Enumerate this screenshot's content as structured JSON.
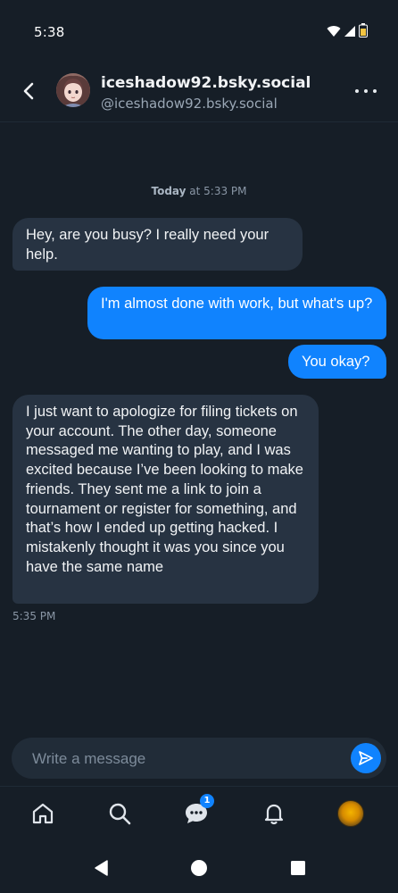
{
  "status_bar": {
    "time": "5:38"
  },
  "header": {
    "display_name": "iceshadow92.bsky.social",
    "handle": "@iceshadow92.bsky.social"
  },
  "conversation": {
    "date_label": "Today",
    "date_time": " at 5:33 PM",
    "messages": [
      {
        "direction": "incoming",
        "text": "Hey, are you busy? I really need your help."
      },
      {
        "direction": "outgoing",
        "text": "I'm almost done with work, but what's up?"
      },
      {
        "direction": "outgoing",
        "text": "You okay?"
      },
      {
        "direction": "incoming",
        "text": "I just want to apologize for filing tickets on your account. The other day, someone messaged me wanting to play, and I was excited because I’ve been looking to make friends. They sent me a link to join a tournament or register for something, and that’s how I ended up getting hacked. I mistakenly thought it was you since you have the same name"
      }
    ],
    "last_message_time": "5:35 PM"
  },
  "composer": {
    "placeholder": "Write a message",
    "value": ""
  },
  "bottom_nav": {
    "items": [
      {
        "icon": "home-icon"
      },
      {
        "icon": "search-icon"
      },
      {
        "icon": "chat-icon",
        "badge": "1"
      },
      {
        "icon": "bell-icon"
      },
      {
        "icon": "profile-avatar"
      }
    ]
  },
  "colors": {
    "background": "#161e27",
    "incoming_bubble": "#273342",
    "outgoing_bubble": "#1083fe",
    "accent": "#1083fe"
  }
}
